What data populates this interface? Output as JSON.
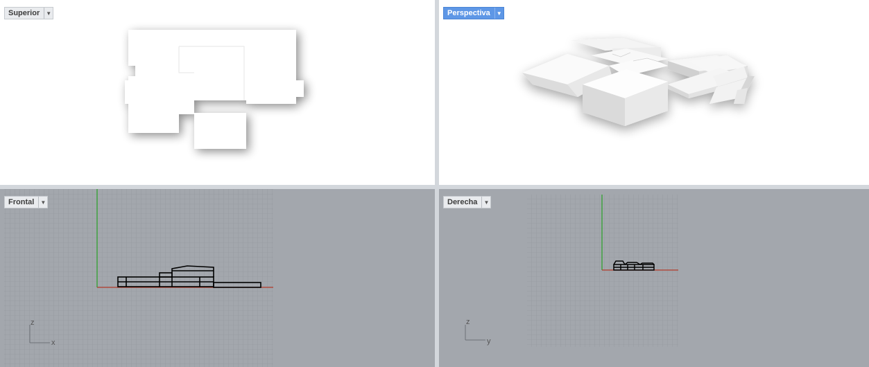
{
  "viewports": {
    "top": {
      "title": "Superior",
      "menu_icon": "dropdown-arrow-icon"
    },
    "perspective": {
      "title": "Perspectiva",
      "menu_icon": "dropdown-arrow-icon",
      "active": true
    },
    "front": {
      "title": "Frontal",
      "menu_icon": "dropdown-arrow-icon",
      "axis_vertical": "z",
      "axis_horizontal": "x"
    },
    "right": {
      "title": "Derecha",
      "menu_icon": "dropdown-arrow-icon",
      "axis_vertical": "z",
      "axis_horizontal": "y"
    }
  },
  "colors": {
    "active_tab": "#5e97e6",
    "grid_bg": "#a3a7ad",
    "grid_line": "#8f9399",
    "axis_green": "#2fa12f",
    "axis_red": "#b23a2a"
  }
}
